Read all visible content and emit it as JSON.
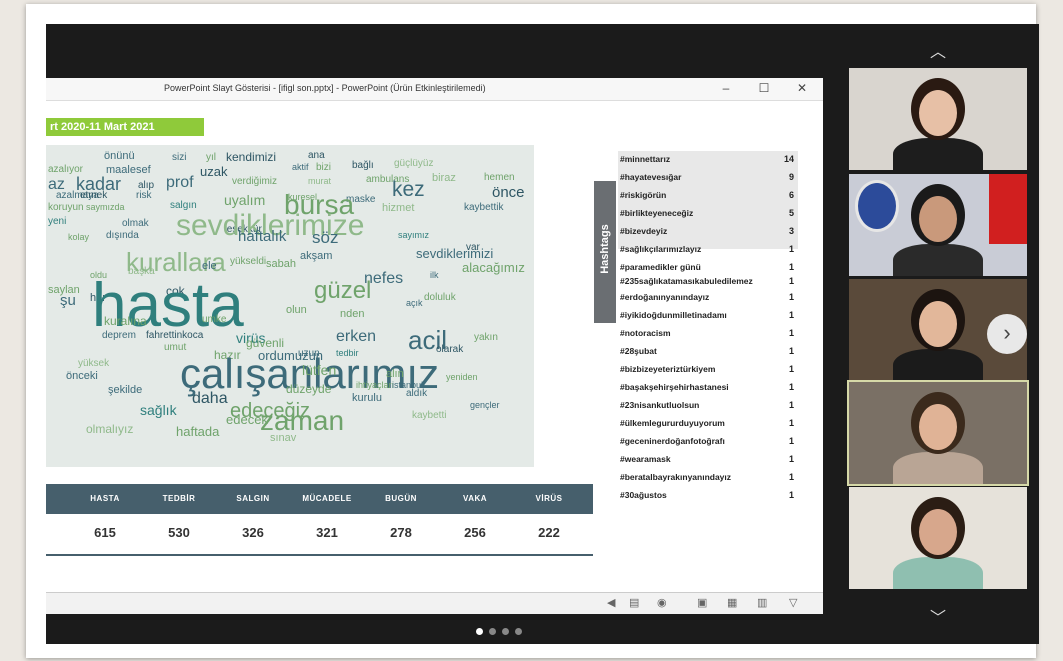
{
  "window": {
    "title": "PowerPoint Slayt Gösterisi - [ifigl son.pptx] - PowerPoint (Ürün Etkinleştirilemedi)",
    "minimize": "–",
    "maximize": "☐",
    "close": "✕"
  },
  "slide": {
    "date_range": "rt 2020-11 Mart 2021",
    "hashtag_heading": "Hashtags"
  },
  "word_cloud": [
    {
      "w": "önünü",
      "c": "#3d6b7a"
    },
    {
      "w": "sizi",
      "c": "#3d6b7a"
    },
    {
      "w": "yıl",
      "c": "#6fa36b"
    },
    {
      "w": "kendimizi",
      "c": "#2e5664"
    },
    {
      "w": "ana",
      "c": "#2e5664"
    },
    {
      "w": "azalıyor",
      "c": "#6fa36b"
    },
    {
      "w": "maalesef",
      "c": "#3d6b7a"
    },
    {
      "w": "uzak",
      "c": "#2e5664"
    },
    {
      "w": "aktif",
      "c": "#3d6b7a"
    },
    {
      "w": "bizi",
      "c": "#6fa36b"
    },
    {
      "w": "bağlı",
      "c": "#2e5664"
    },
    {
      "w": "güçlüyüz",
      "c": "#8fb98a"
    },
    {
      "w": "az",
      "c": "#3d6b7a"
    },
    {
      "w": "kadar",
      "c": "#3d6b7a"
    },
    {
      "w": "alıp",
      "c": "#2e5664"
    },
    {
      "w": "prof",
      "c": "#3d6b7a"
    },
    {
      "w": "verdiğimiz",
      "c": "#6fa36b"
    },
    {
      "w": "murat",
      "c": "#8fb98a"
    },
    {
      "w": "ambulans",
      "c": "#6fa36b"
    },
    {
      "w": "biraz",
      "c": "#8fb98a"
    },
    {
      "w": "hemen",
      "c": "#6fa36b"
    },
    {
      "w": "azalmaya",
      "c": "#3d6b7a"
    },
    {
      "w": "etmek",
      "c": "#2e5664"
    },
    {
      "w": "risk",
      "c": "#3d6b7a"
    },
    {
      "w": "uyalım",
      "c": "#6fa36b"
    },
    {
      "w": "kuresel",
      "c": "#6fa36b"
    },
    {
      "w": "maske",
      "c": "#3d6b7a"
    },
    {
      "w": "kez",
      "c": "#3d6b7a"
    },
    {
      "w": "önce",
      "c": "#2e5664"
    },
    {
      "w": "koruyun",
      "c": "#6fa36b"
    },
    {
      "w": "saymızda",
      "c": "#6fa36b"
    },
    {
      "w": "salgın",
      "c": "#2f7f7d"
    },
    {
      "w": "bursa",
      "c": "#6fa36b"
    },
    {
      "w": "hizmet",
      "c": "#8fb98a"
    },
    {
      "w": "kaybettik",
      "c": "#3d6b7a"
    },
    {
      "w": "yeni",
      "c": "#2f7f7d"
    },
    {
      "w": "olmak",
      "c": "#3d6b7a"
    },
    {
      "w": "teşekkür",
      "c": "#2e5664"
    },
    {
      "w": "sevdiklerimize",
      "c": "#8fb98a"
    },
    {
      "w": "haftalık",
      "c": "#3d6b7a"
    },
    {
      "w": "söz",
      "c": "#3d6b7a"
    },
    {
      "w": "sayımız",
      "c": "#2f7f7d"
    },
    {
      "w": "kolay",
      "c": "#6fa36b"
    },
    {
      "w": "dışında",
      "c": "#3d6b7a"
    },
    {
      "w": "kurallara",
      "c": "#8fb98a"
    },
    {
      "w": "yükseldi",
      "c": "#6fa36b"
    },
    {
      "w": "sabah",
      "c": "#6fa36b"
    },
    {
      "w": "akşam",
      "c": "#3d6b7a"
    },
    {
      "w": "sevdiklerimizi",
      "c": "#3d6b7a"
    },
    {
      "w": "var",
      "c": "#2e5664"
    },
    {
      "w": "oldu",
      "c": "#6fa36b"
    },
    {
      "w": "başka",
      "c": "#8fb98a"
    },
    {
      "w": "ele",
      "c": "#3d6b7a"
    },
    {
      "w": "güzel",
      "c": "#6fa36b"
    },
    {
      "w": "nefes",
      "c": "#3d6b7a"
    },
    {
      "w": "ilk",
      "c": "#3d6b7a"
    },
    {
      "w": "alacağımız",
      "c": "#6fa36b"
    },
    {
      "w": "saylan",
      "c": "#6fa36b"
    },
    {
      "w": "her",
      "c": "#2e5664"
    },
    {
      "w": "çok",
      "c": "#2e5664"
    },
    {
      "w": "şu",
      "c": "#3d6b7a"
    },
    {
      "w": "hasta",
      "c": "#2f7f7d"
    },
    {
      "w": "doluluk",
      "c": "#6fa36b"
    },
    {
      "w": "kuralına",
      "c": "#6fa36b"
    },
    {
      "w": "umke",
      "c": "#6fa36b"
    },
    {
      "w": "olun",
      "c": "#6fa36b"
    },
    {
      "w": "nden",
      "c": "#6fa36b"
    },
    {
      "w": "açık",
      "c": "#3d6b7a"
    },
    {
      "w": "deprem",
      "c": "#3d6b7a"
    },
    {
      "w": "fahrettinkoca",
      "c": "#2e5664"
    },
    {
      "w": "virüs",
      "c": "#2f7f7d"
    },
    {
      "w": "güvenli",
      "c": "#6fa36b"
    },
    {
      "w": "erken",
      "c": "#3d6b7a"
    },
    {
      "w": "acil",
      "c": "#3d6b7a"
    },
    {
      "w": "yakın",
      "c": "#6fa36b"
    },
    {
      "w": "umut",
      "c": "#6fa36b"
    },
    {
      "w": "hazır",
      "c": "#6fa36b"
    },
    {
      "w": "ordumuzun",
      "c": "#3d6b7a"
    },
    {
      "w": "uzun",
      "c": "#3d6b7a"
    },
    {
      "w": "tedbir",
      "c": "#2f7f7d"
    },
    {
      "w": "olarak",
      "c": "#2e5664"
    },
    {
      "w": "yüksek",
      "c": "#8fb98a"
    },
    {
      "w": "çalışanlarımız",
      "c": "#3d6b7a"
    },
    {
      "w": "lütfen",
      "c": "#6fa36b"
    },
    {
      "w": "alın",
      "c": "#6fa36b"
    },
    {
      "w": "önceki",
      "c": "#3d6b7a"
    },
    {
      "w": "ihtiyaçları",
      "c": "#6fa36b"
    },
    {
      "w": "istanbul",
      "c": "#3d6b7a"
    },
    {
      "w": "yeniden",
      "c": "#6fa36b"
    },
    {
      "w": "şekilde",
      "c": "#3d6b7a"
    },
    {
      "w": "daha",
      "c": "#2e5664"
    },
    {
      "w": "düzeyde",
      "c": "#6fa36b"
    },
    {
      "w": "aldık",
      "c": "#3d6b7a"
    },
    {
      "w": "sağlık",
      "c": "#2f7f7d"
    },
    {
      "w": "edeceğiz",
      "c": "#6fa36b"
    },
    {
      "w": "kurulu",
      "c": "#3d6b7a"
    },
    {
      "w": "gençler",
      "c": "#3d6b7a"
    },
    {
      "w": "edecek",
      "c": "#6fa36b"
    },
    {
      "w": "zaman",
      "c": "#6fa36b"
    },
    {
      "w": "kaybetti",
      "c": "#8fb98a"
    },
    {
      "w": "olmalıyız",
      "c": "#8fb98a"
    },
    {
      "w": "haftada",
      "c": "#6fa36b"
    },
    {
      "w": "sınav",
      "c": "#8fb98a"
    }
  ],
  "table": {
    "headers": [
      "HASTA",
      "TEDBİR",
      "SALGIN",
      "MÜCADELE",
      "BUGÜN",
      "VAKA",
      "VİRÜS"
    ],
    "values": [
      "615",
      "530",
      "326",
      "321",
      "278",
      "256",
      "222"
    ]
  },
  "hashtags": [
    {
      "tag": "#minnettarız",
      "count": "14"
    },
    {
      "tag": "#hayatevesığar",
      "count": "9"
    },
    {
      "tag": "#riskigörün",
      "count": "6"
    },
    {
      "tag": "#birlikteyeneceğiz",
      "count": "5"
    },
    {
      "tag": "#bizevdeyiz",
      "count": "3"
    },
    {
      "tag": "#sağlıkçılarımızlayız",
      "count": "1"
    },
    {
      "tag": "#paramedikler günü",
      "count": "1"
    },
    {
      "tag": "#235sağlıkatamasıkabuledilemez",
      "count": "1"
    },
    {
      "tag": "#erdoğanınyanındayız",
      "count": "1"
    },
    {
      "tag": "#iyikidoğdunmilletinadamı",
      "count": "1"
    },
    {
      "tag": "#notoracism",
      "count": "1"
    },
    {
      "tag": "#28şubat",
      "count": "1"
    },
    {
      "tag": "#bizbizeyeteriztürkiyem",
      "count": "1"
    },
    {
      "tag": "#başakşehirşehirhastanesi",
      "count": "1"
    },
    {
      "tag": "#23nisankutluolsun",
      "count": "1"
    },
    {
      "tag": "#ülkemlegururduyuyorum",
      "count": "1"
    },
    {
      "tag": "#geceninerdoğanfotoğrafı",
      "count": "1"
    },
    {
      "tag": "#wearamask",
      "count": "1"
    },
    {
      "tag": "#beratalbayrakınyanındayız",
      "count": "1"
    },
    {
      "tag": "#30ağustos",
      "count": "1"
    }
  ],
  "participants": [
    {
      "id": "p1",
      "bg": "#d9d5cf",
      "hair": "#2a1a12",
      "skin": "#e7c0a6",
      "shirt": "#1d1d1d"
    },
    {
      "id": "p2",
      "bg": "#c9ccd6",
      "hair": "#1a1a1a",
      "skin": "#c9997b",
      "shirt": "#2a2a2a"
    },
    {
      "id": "p3",
      "bg": "#5a4a3a",
      "hair": "#1c1410",
      "skin": "#e2b79a",
      "shirt": "#1b1b1b"
    },
    {
      "id": "p4",
      "bg": "#7a7065",
      "hair": "#3b2a1c",
      "skin": "#e0b396",
      "shirt": "#b9a595"
    },
    {
      "id": "p5",
      "bg": "#e6e2da",
      "hair": "#2b1d14",
      "skin": "#d7a78c",
      "shirt": "#8fbfb0"
    }
  ],
  "colors": {
    "accent_green": "#8fca3a",
    "table_header": "#465f6c",
    "active_speaker_border": "#d6d9a8"
  },
  "icons": {
    "scroll_up": "︿",
    "scroll_down": "﹀",
    "next": "›"
  }
}
